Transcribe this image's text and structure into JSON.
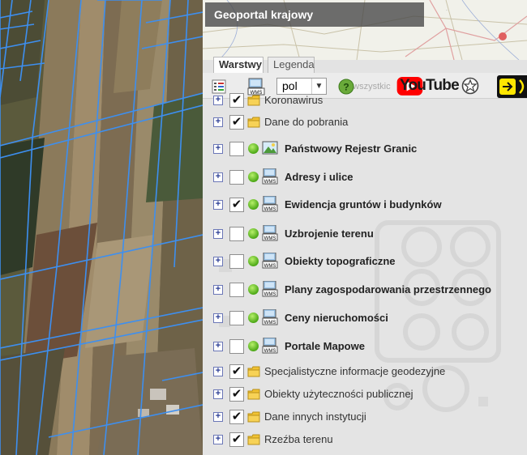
{
  "header": {
    "title": "Geoportal krajowy"
  },
  "tabs": [
    {
      "label": "Warstwy",
      "active": true
    },
    {
      "label": "Legenda",
      "active": false
    }
  ],
  "toolbar": {
    "language": "pol",
    "ghost_text": "o wszystkic",
    "youtube_label": "YouTube"
  },
  "layers": [
    {
      "label": "Koronawirus",
      "checked": true,
      "kind": "folder",
      "bold": false
    },
    {
      "label": "Dane do pobrania",
      "checked": true,
      "kind": "folder",
      "bold": false
    },
    {
      "label": "Państwowy Rejestr Granic",
      "checked": false,
      "kind": "image",
      "bold": true
    },
    {
      "label": "Adresy i ulice",
      "checked": false,
      "kind": "wms",
      "bold": true
    },
    {
      "label": "Ewidencja gruntów i budynków",
      "checked": true,
      "kind": "wms",
      "bold": true
    },
    {
      "label": "Uzbrojenie terenu",
      "checked": false,
      "kind": "wms",
      "bold": true
    },
    {
      "label": "Obiekty topograficzne",
      "checked": false,
      "kind": "wms",
      "bold": true
    },
    {
      "label": "Plany zagospodarowania przestrzennego",
      "checked": false,
      "kind": "wms",
      "bold": true
    },
    {
      "label": "Ceny nieruchomości",
      "checked": false,
      "kind": "wms",
      "bold": true
    },
    {
      "label": "Portale Mapowe",
      "checked": false,
      "kind": "wms",
      "bold": true
    },
    {
      "label": "Specjalistyczne informacje geodezyjne",
      "checked": true,
      "kind": "folder",
      "bold": false
    },
    {
      "label": "Obiekty użyteczności publicznej",
      "checked": true,
      "kind": "folder",
      "bold": false
    },
    {
      "label": "Dane innych instytucji",
      "checked": true,
      "kind": "folder",
      "bold": false
    },
    {
      "label": "Rzeźba terenu",
      "checked": true,
      "kind": "folder",
      "bold": false
    }
  ],
  "colors": {
    "parcel_line": "#3d8ff0",
    "title_bg": "#464646",
    "wms_dot": "#4ca817"
  }
}
